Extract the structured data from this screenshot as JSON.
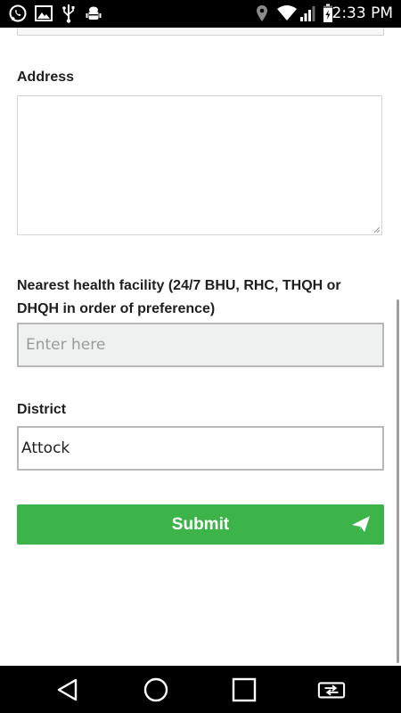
{
  "status_bar": {
    "time": "2:33 PM",
    "icons": [
      "whatsapp-icon",
      "gallery-icon",
      "usb-icon",
      "android-debug-icon",
      "location-icon",
      "wifi-icon",
      "signal-icon",
      "battery-icon"
    ]
  },
  "form": {
    "address_label": "Address",
    "address_value": "",
    "facility_label": "Nearest health facility (24/7 BHU, RHC, THQH or DHQH in order of preference)",
    "facility_placeholder": "Enter here",
    "district_label": "District",
    "district_value": "Attock",
    "submit_label": "Submit"
  },
  "nav_bar": {
    "buttons": [
      "back-icon",
      "home-icon",
      "recents-icon",
      "switch-app-icon"
    ]
  },
  "colors": {
    "accent": "#3cb44a",
    "status_bar": "#000000",
    "input_disabled_bg": "#eef1f0"
  }
}
